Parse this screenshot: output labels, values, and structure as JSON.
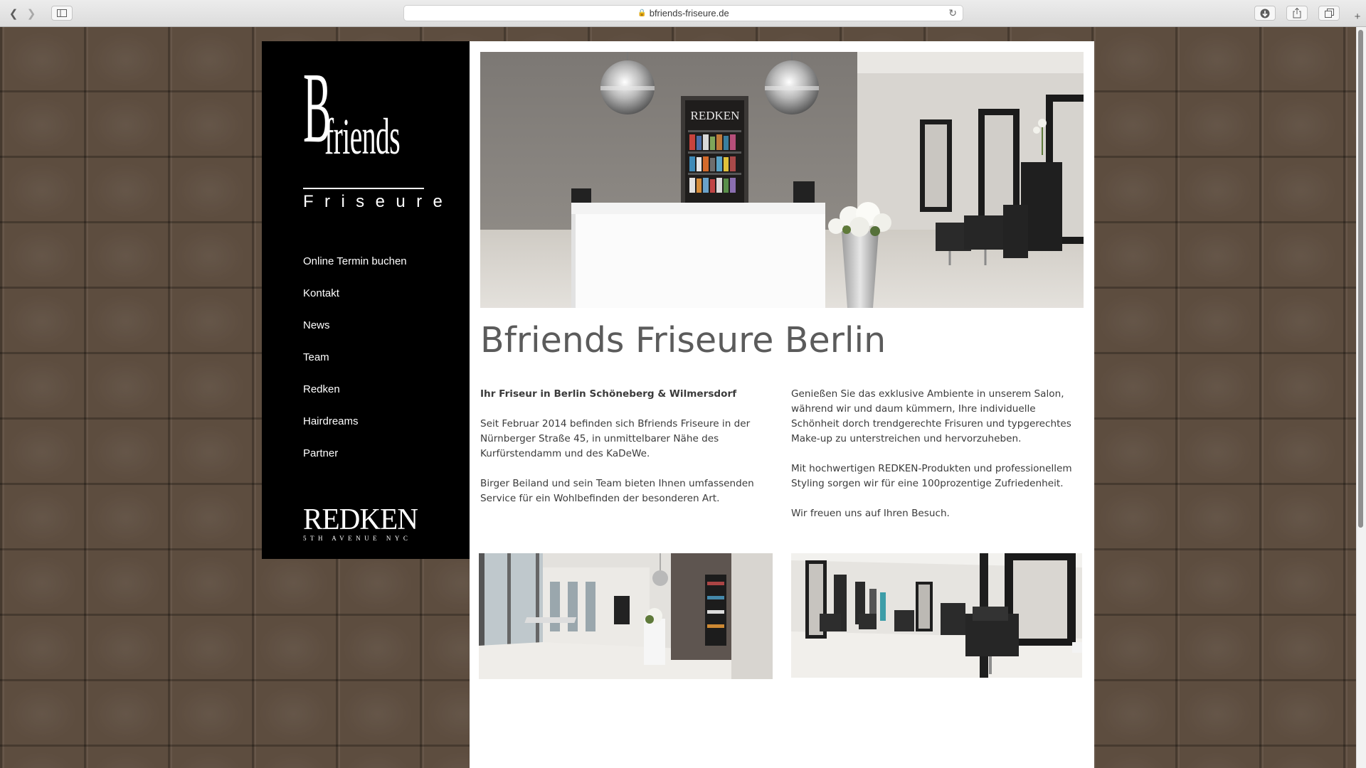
{
  "browser": {
    "url": "bfriends-friseure.de"
  },
  "logo": {
    "letter": "B",
    "word": "friends",
    "subtitle": "Friseure"
  },
  "menu": [
    {
      "label": "Online Termin buchen"
    },
    {
      "label": "Kontakt"
    },
    {
      "label": "News"
    },
    {
      "label": "Team"
    },
    {
      "label": "Redken"
    },
    {
      "label": "Hairdreams"
    },
    {
      "label": "Partner"
    }
  ],
  "redken": {
    "word": "REDKEN",
    "tagline": "5TH AVENUE NYC"
  },
  "hero": {
    "sign": "REDKEN"
  },
  "content": {
    "title": "Bfriends Friseure Berlin",
    "left": {
      "lead": "Ihr Friseur in Berlin Schöneberg & Wilmersdorf",
      "p1": "Seit Februar 2014 befinden sich Bfriends Friseure in der Nürnberger Straße 45, in unmittelbarer Nähe des Kurfürstendamm und des KaDeWe.",
      "p2": "Birger Beiland und sein Team bieten Ihnen umfassenden Service für ein Wohlbefinden der besonderen Art."
    },
    "right": {
      "p1": "Genießen Sie das exklusive Ambiente in unserem Salon, während wir und daum  kümmern, Ihre individuelle Schönheit dorch trendgerechte Frisuren und typgerechtes Make-up zu unterstreichen und hervorzuheben.",
      "p2": "Mit hochwertigen REDKEN-Produkten und professionellem Styling sorgen wir für eine 100prozentige Zufriedenheit.",
      "p3": "Wir freuen uns auf Ihren Besuch."
    }
  }
}
